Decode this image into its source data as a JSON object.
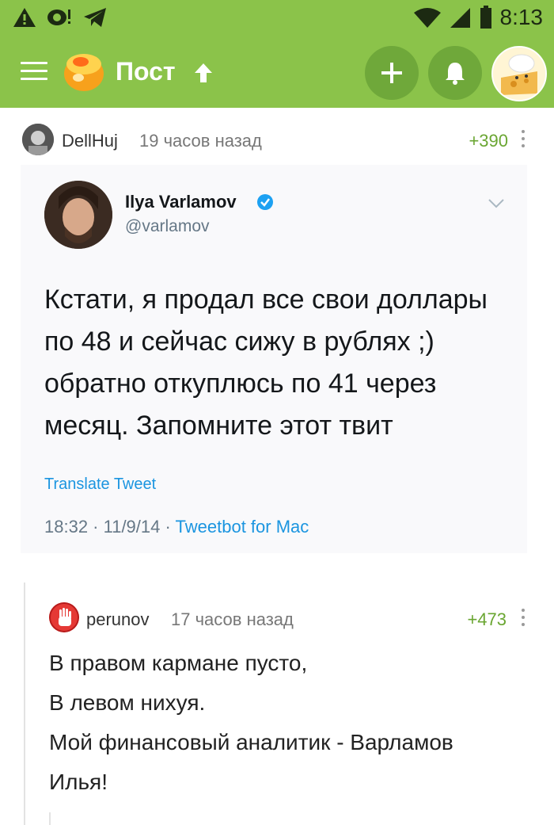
{
  "status_bar": {
    "time": "8:13",
    "icons": [
      "warning-icon",
      "chat-notification-icon",
      "telegram-icon",
      "wifi-icon",
      "signal-icon",
      "battery-icon"
    ]
  },
  "app_bar": {
    "title": "Пост",
    "icons": [
      "menu-icon",
      "pikabu-logo",
      "arrow-up-icon",
      "add-icon",
      "bell-icon",
      "user-avatar"
    ],
    "accent_color": "#8bc34a"
  },
  "post": {
    "author": "DellHuj",
    "time_ago": "19 часов назад",
    "rating": "+390",
    "tweet": {
      "name": "Ilya Varlamov",
      "handle": "@varlamov",
      "text": "Кстати, я продал все свои доллары по 48 и сейчас сижу в рублях ;) обратно откуплюсь по 41 через месяц. Запомните этот твит",
      "translate_label": "Translate Tweet",
      "date": "18:32 · 11/9/14 · ",
      "source": "Tweetbot for Mac"
    }
  },
  "comment": {
    "author": "perunov",
    "time_ago": "17 часов назад",
    "rating": "+473",
    "lines": [
      "В правом кармане пусто,",
      "В левом нихуя.",
      "Мой финансовый аналитик - Варламов",
      "Илья!"
    ]
  }
}
